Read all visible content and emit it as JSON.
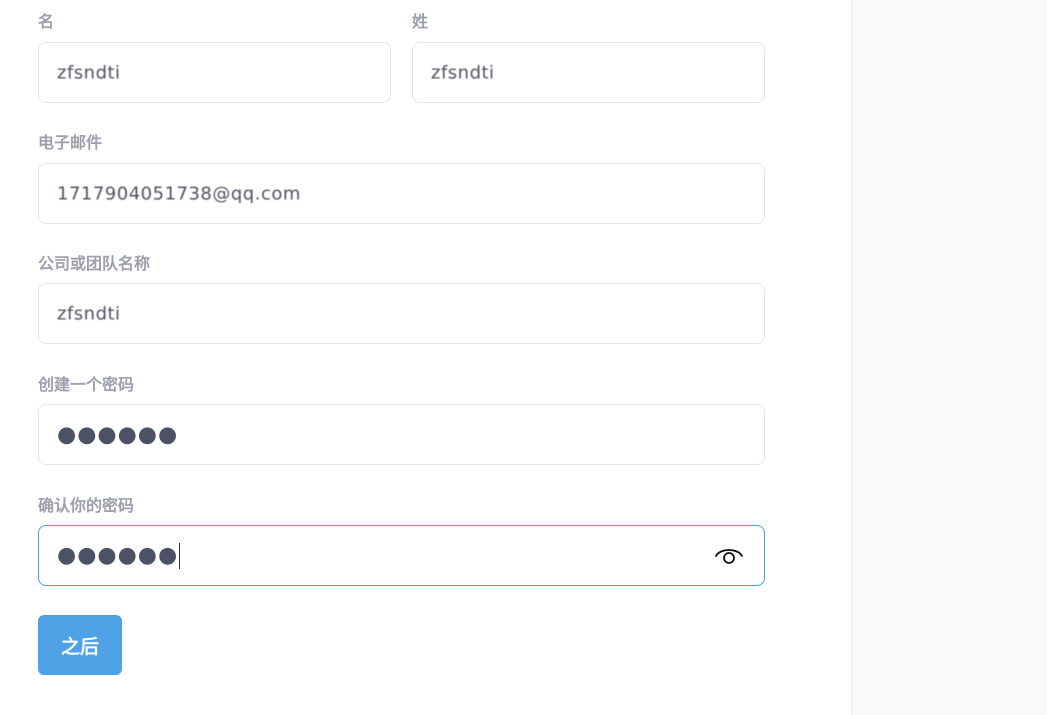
{
  "form": {
    "first_name": {
      "label": "名",
      "value": "zfsndti"
    },
    "last_name": {
      "label": "姓",
      "value": "zfsndti"
    },
    "email": {
      "label": "电子邮件",
      "value": "1717904051738@qq.com"
    },
    "company": {
      "label": "公司或团队名称",
      "value": "zfsndti"
    },
    "password": {
      "label": "创建一个密码",
      "value": "●●●●●●"
    },
    "confirm_password": {
      "label": "确认你的密码",
      "value": "●●●●●●"
    },
    "next_button_label": "之后"
  },
  "icons": {
    "toggle_visibility": "eye-icon"
  },
  "colors": {
    "accent": "#4fa2e6",
    "focus_border": "#4a9fd8",
    "label": "#9ca0ad",
    "side_panel": "#f9fafc"
  }
}
